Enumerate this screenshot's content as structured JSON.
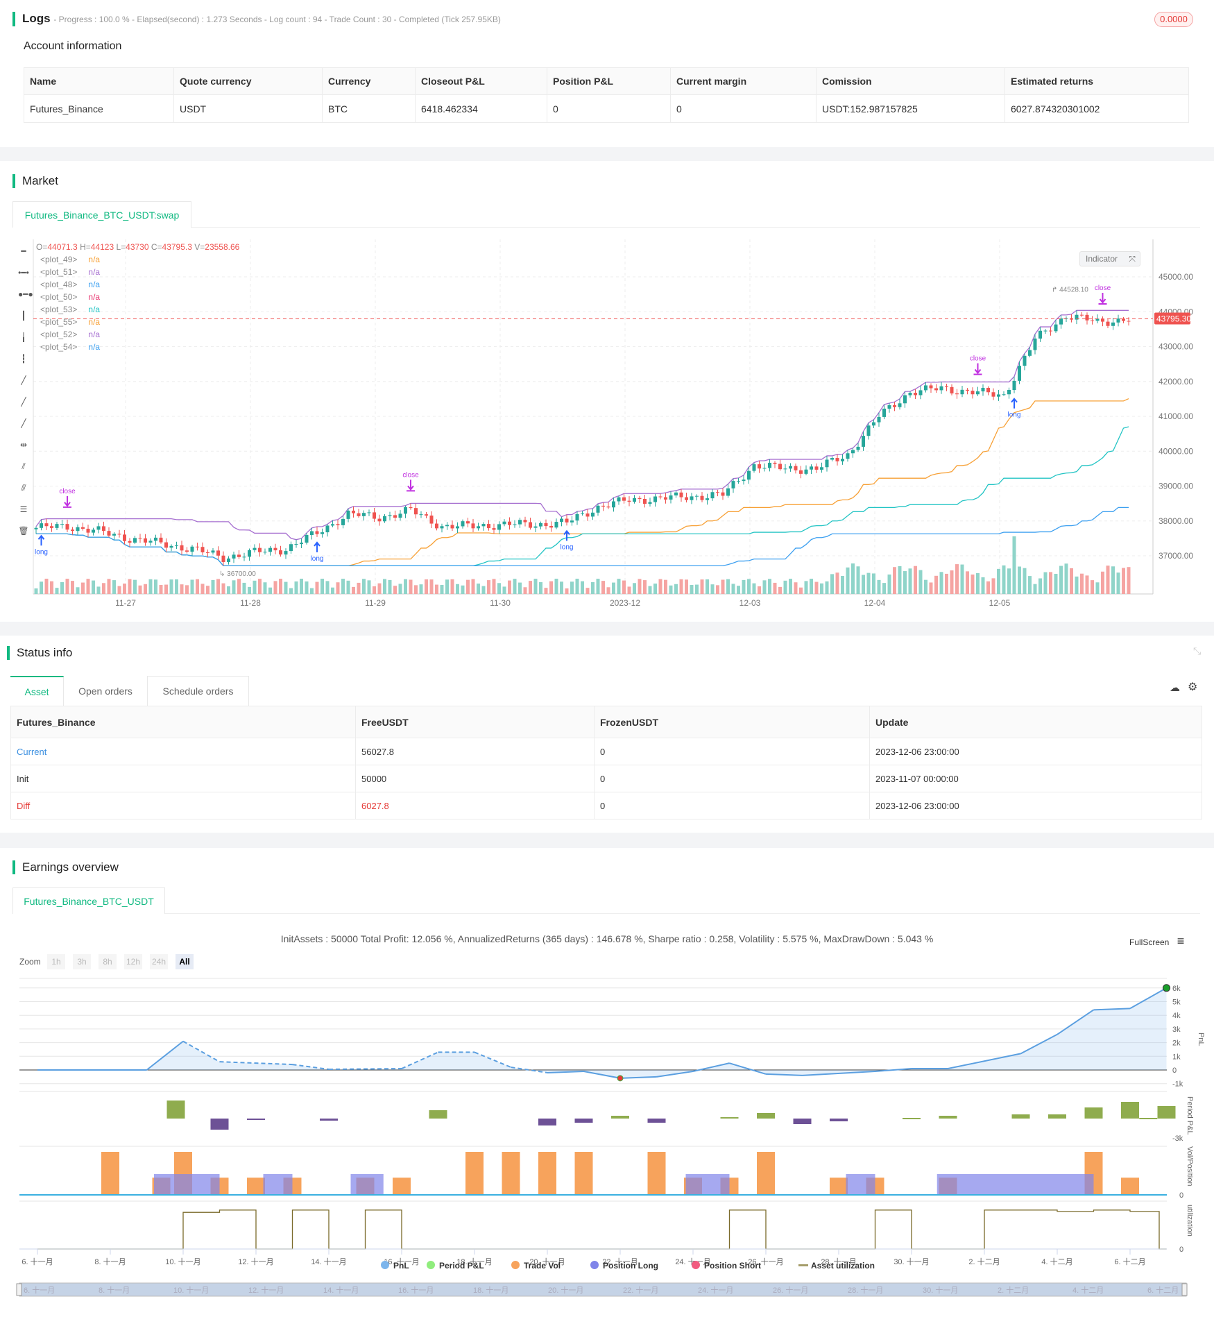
{
  "logs": {
    "title": "Logs",
    "summary": "- Progress : 100.0 % - Elapsed(second) : 1.273  Seconds - Log count : 94 - Trade Count : 30 - Completed (Tick 257.95KB)",
    "badge": "0.0000"
  },
  "account": {
    "title": "Account information",
    "headers": [
      "Name",
      "Quote currency",
      "Currency",
      "Closeout P&L",
      "Position P&L",
      "Current margin",
      "Comission",
      "Estimated returns"
    ],
    "row": [
      "Futures_Binance",
      "USDT",
      "BTC",
      "6418.462334",
      "0",
      "0",
      "USDT:152.987157825",
      "6027.874320301002"
    ]
  },
  "market": {
    "title": "Market",
    "tab": "Futures_Binance_BTC_USDT:swap",
    "ohlc": {
      "o_label": "O=",
      "o": "44071.3",
      "h_label": " H=",
      "h": "44123",
      "l_label": " L=",
      "l": "43730",
      "c_label": " C=",
      "c": "43795.3",
      "v_label": " V=",
      "v": "23558.66"
    },
    "plots": [
      {
        "name": "<plot_49>",
        "value": "n/a",
        "color": "#f7a035"
      },
      {
        "name": "<plot_51>",
        "value": "n/a",
        "color": "#a66fd0"
      },
      {
        "name": "<plot_48>",
        "value": "n/a",
        "color": "#3b9ff0"
      },
      {
        "name": "<plot_50>",
        "value": "n/a",
        "color": "#e8336e"
      },
      {
        "name": "<plot_53>",
        "value": "n/a",
        "color": "#22c4c4"
      },
      {
        "name": "<plot_55>",
        "value": "n/a",
        "color": "#f7a035"
      },
      {
        "name": "<plot_52>",
        "value": "n/a",
        "color": "#a66fd0"
      },
      {
        "name": "<plot_54>",
        "value": "n/a",
        "color": "#3b9ff0"
      }
    ],
    "indicator_label": "Indicator",
    "last_price": "43795.30",
    "high_marker": "44528.10",
    "low_marker": "36700.00",
    "price_ticks": [
      "45000.00",
      "44000.00",
      "43000.00",
      "42000.00",
      "41000.00",
      "40000.00",
      "39000.00",
      "38000.00",
      "37000.00"
    ],
    "date_ticks": [
      "11-27",
      "11-28",
      "11-29",
      "11-30",
      "2023-12",
      "12-03",
      "12-04",
      "12-05"
    ],
    "signals": [
      {
        "label": "close",
        "bar": 6,
        "type": "close"
      },
      {
        "label": "long",
        "bar": 1,
        "type": "long"
      },
      {
        "label": "long",
        "bar": 54,
        "type": "long"
      },
      {
        "label": "close",
        "bar": 72,
        "type": "close"
      },
      {
        "label": "long",
        "bar": 102,
        "type": "long"
      },
      {
        "label": "close",
        "bar": 181,
        "type": "close"
      },
      {
        "label": "long",
        "bar": 188,
        "type": "long"
      },
      {
        "label": "close",
        "bar": 205,
        "type": "close"
      }
    ]
  },
  "chart_data": [
    {
      "type": "candlestick",
      "title": "Futures_Binance_BTC_USDT:swap",
      "interval": "1h",
      "ylim": [
        36500,
        45500
      ],
      "anchor_every_bars": 6,
      "close_anchors": [
        37800,
        37850,
        37700,
        37500,
        37350,
        37200,
        36950,
        37100,
        37200,
        37650,
        38200,
        38100,
        38300,
        37850,
        37850,
        37900,
        37900,
        37950,
        38400,
        38600,
        38650,
        38700,
        38750,
        39600,
        39500,
        39500,
        39900,
        41000,
        41700,
        41800,
        41700,
        41600,
        43200,
        43900,
        43700,
        43795
      ]
    },
    {
      "type": "line",
      "title": "PnL",
      "x_unit": "day (Nov 6 = 6)",
      "points": [
        [
          6,
          0
        ],
        [
          9,
          0
        ],
        [
          10,
          2100
        ],
        [
          11,
          600
        ],
        [
          13,
          400
        ],
        [
          14,
          50
        ],
        [
          16,
          100
        ],
        [
          17,
          1300
        ],
        [
          18,
          1300
        ],
        [
          19,
          200
        ],
        [
          20,
          -200
        ],
        [
          21,
          -100
        ],
        [
          22,
          -600
        ],
        [
          23,
          -500
        ],
        [
          24,
          -100
        ],
        [
          25,
          500
        ],
        [
          26,
          -300
        ],
        [
          27,
          -400
        ],
        [
          29,
          -100
        ],
        [
          30,
          100
        ],
        [
          31,
          100
        ],
        [
          33,
          1200
        ],
        [
          34,
          2600
        ],
        [
          35,
          4400
        ],
        [
          36,
          4500
        ],
        [
          37,
          6000
        ]
      ],
      "yticks": [
        "6k",
        "5k",
        "4k",
        "3k",
        "2k",
        "1k",
        "0",
        "-1k"
      ]
    },
    {
      "type": "bar",
      "title": "Period P&L",
      "points": [
        [
          9.8,
          1300
        ],
        [
          11,
          -800
        ],
        [
          12,
          -50
        ],
        [
          14,
          -150
        ],
        [
          17,
          600
        ],
        [
          20,
          -500
        ],
        [
          21,
          -300
        ],
        [
          22,
          200
        ],
        [
          23,
          -300
        ],
        [
          25,
          100
        ],
        [
          26,
          400
        ],
        [
          27,
          -400
        ],
        [
          28,
          -200
        ],
        [
          30,
          50
        ],
        [
          31,
          200
        ],
        [
          33,
          300
        ],
        [
          34,
          300
        ],
        [
          35,
          800
        ],
        [
          36,
          1200
        ],
        [
          36.5,
          50
        ],
        [
          37,
          900
        ]
      ],
      "ytick": "-3k"
    },
    {
      "type": "bar",
      "title": "Vol/Position",
      "trade_vol": [
        [
          8,
          1
        ],
        [
          9.4,
          0.4
        ],
        [
          10,
          1
        ],
        [
          11,
          0.4
        ],
        [
          12,
          0.4
        ],
        [
          13,
          0.4
        ],
        [
          15,
          0.4
        ],
        [
          16,
          0.4
        ],
        [
          18,
          1
        ],
        [
          19,
          1
        ],
        [
          20,
          1
        ],
        [
          21,
          1
        ],
        [
          23,
          1
        ],
        [
          24,
          0.4
        ],
        [
          25,
          0.4
        ],
        [
          26,
          1
        ],
        [
          28,
          0.4
        ],
        [
          29,
          0.4
        ],
        [
          31,
          0.4
        ],
        [
          35,
          1
        ],
        [
          36,
          0.4
        ]
      ],
      "position_long": [
        [
          9.2,
          11
        ],
        [
          12.2,
          13
        ],
        [
          14.6,
          15.5
        ],
        [
          23.8,
          25
        ],
        [
          28.2,
          29
        ],
        [
          30.7,
          35
        ]
      ],
      "ytick": "0"
    },
    {
      "type": "line",
      "title": "utilization",
      "steps": [
        [
          6,
          0
        ],
        [
          10,
          0.8
        ],
        [
          11,
          0.85
        ],
        [
          12,
          0
        ],
        [
          13,
          0.85
        ],
        [
          14,
          0
        ],
        [
          15,
          0.85
        ],
        [
          16,
          0
        ],
        [
          25,
          0.85
        ],
        [
          26,
          0
        ],
        [
          29,
          0.85
        ],
        [
          30,
          0
        ],
        [
          32,
          0.85
        ],
        [
          34,
          0.82
        ],
        [
          35,
          0.85
        ],
        [
          36,
          0.82
        ],
        [
          36.8,
          0
        ]
      ],
      "ytick": "0"
    }
  ],
  "status": {
    "title": "Status info",
    "tabs": [
      "Asset",
      "Open orders",
      "Schedule orders"
    ],
    "headers": [
      "Futures_Binance",
      "FreeUSDT",
      "FrozenUSDT",
      "Update"
    ],
    "rows": [
      [
        "Current",
        "56027.8",
        "0",
        "2023-12-06 23:00:00"
      ],
      [
        "Init",
        "50000",
        "0",
        "2023-11-07 00:00:00"
      ],
      [
        "Diff",
        "6027.8",
        "0",
        "2023-12-06 23:00:00"
      ]
    ]
  },
  "earnings": {
    "title": "Earnings overview",
    "tab": "Futures_Binance_BTC_USDT",
    "stats": "InitAssets : 50000 Total Profit: 12.056 %, AnnualizedReturns (365 days) : 146.678 %, Sharpe ratio : 0.258, Volatility : 5.575 %, MaxDrawDown : 5.043 %",
    "fullscreen": "FullScreen",
    "zoom_label": "Zoom",
    "zoom_buttons": [
      "1h",
      "3h",
      "8h",
      "12h",
      "24h",
      "All"
    ],
    "axis_titles": [
      "PnL",
      "Period P&L",
      "Vol/Position",
      "utilization"
    ],
    "x_ticks": [
      "6. 十一月",
      "8. 十一月",
      "10. 十一月",
      "12. 十一月",
      "14. 十一月",
      "16. 十一月",
      "18. 十一月",
      "20. 十一月",
      "22. 十一月",
      "24. 十一月",
      "26. 十一月",
      "28. 十一月",
      "30. 十一月",
      "2. 十二月",
      "4. 十二月",
      "6. 十二月"
    ],
    "nav_ticks": [
      "6. 十一月",
      "8. 十一月",
      "10. 十一月",
      "12. 十一月",
      "14. 十一月",
      "16. 十一月",
      "18. 十一月",
      "20. 十一月",
      "22. 十一月",
      "24. 十一月",
      "26. 十一月",
      "28. 十一月",
      "30. 十一月",
      "2. 十二月",
      "4. 十二月",
      "6. 十二月"
    ],
    "legend": [
      {
        "label": "PnL",
        "color": "#7cb5ec"
      },
      {
        "label": "Period P&L",
        "color": "#90ed7d"
      },
      {
        "label": "Trade Vol",
        "color": "#f7a35c"
      },
      {
        "label": "Position Long",
        "color": "#8085e9"
      },
      {
        "label": "Position Short",
        "color": "#f15c80"
      },
      {
        "label": "Asset utilization",
        "color": "#a59d6a"
      }
    ]
  }
}
